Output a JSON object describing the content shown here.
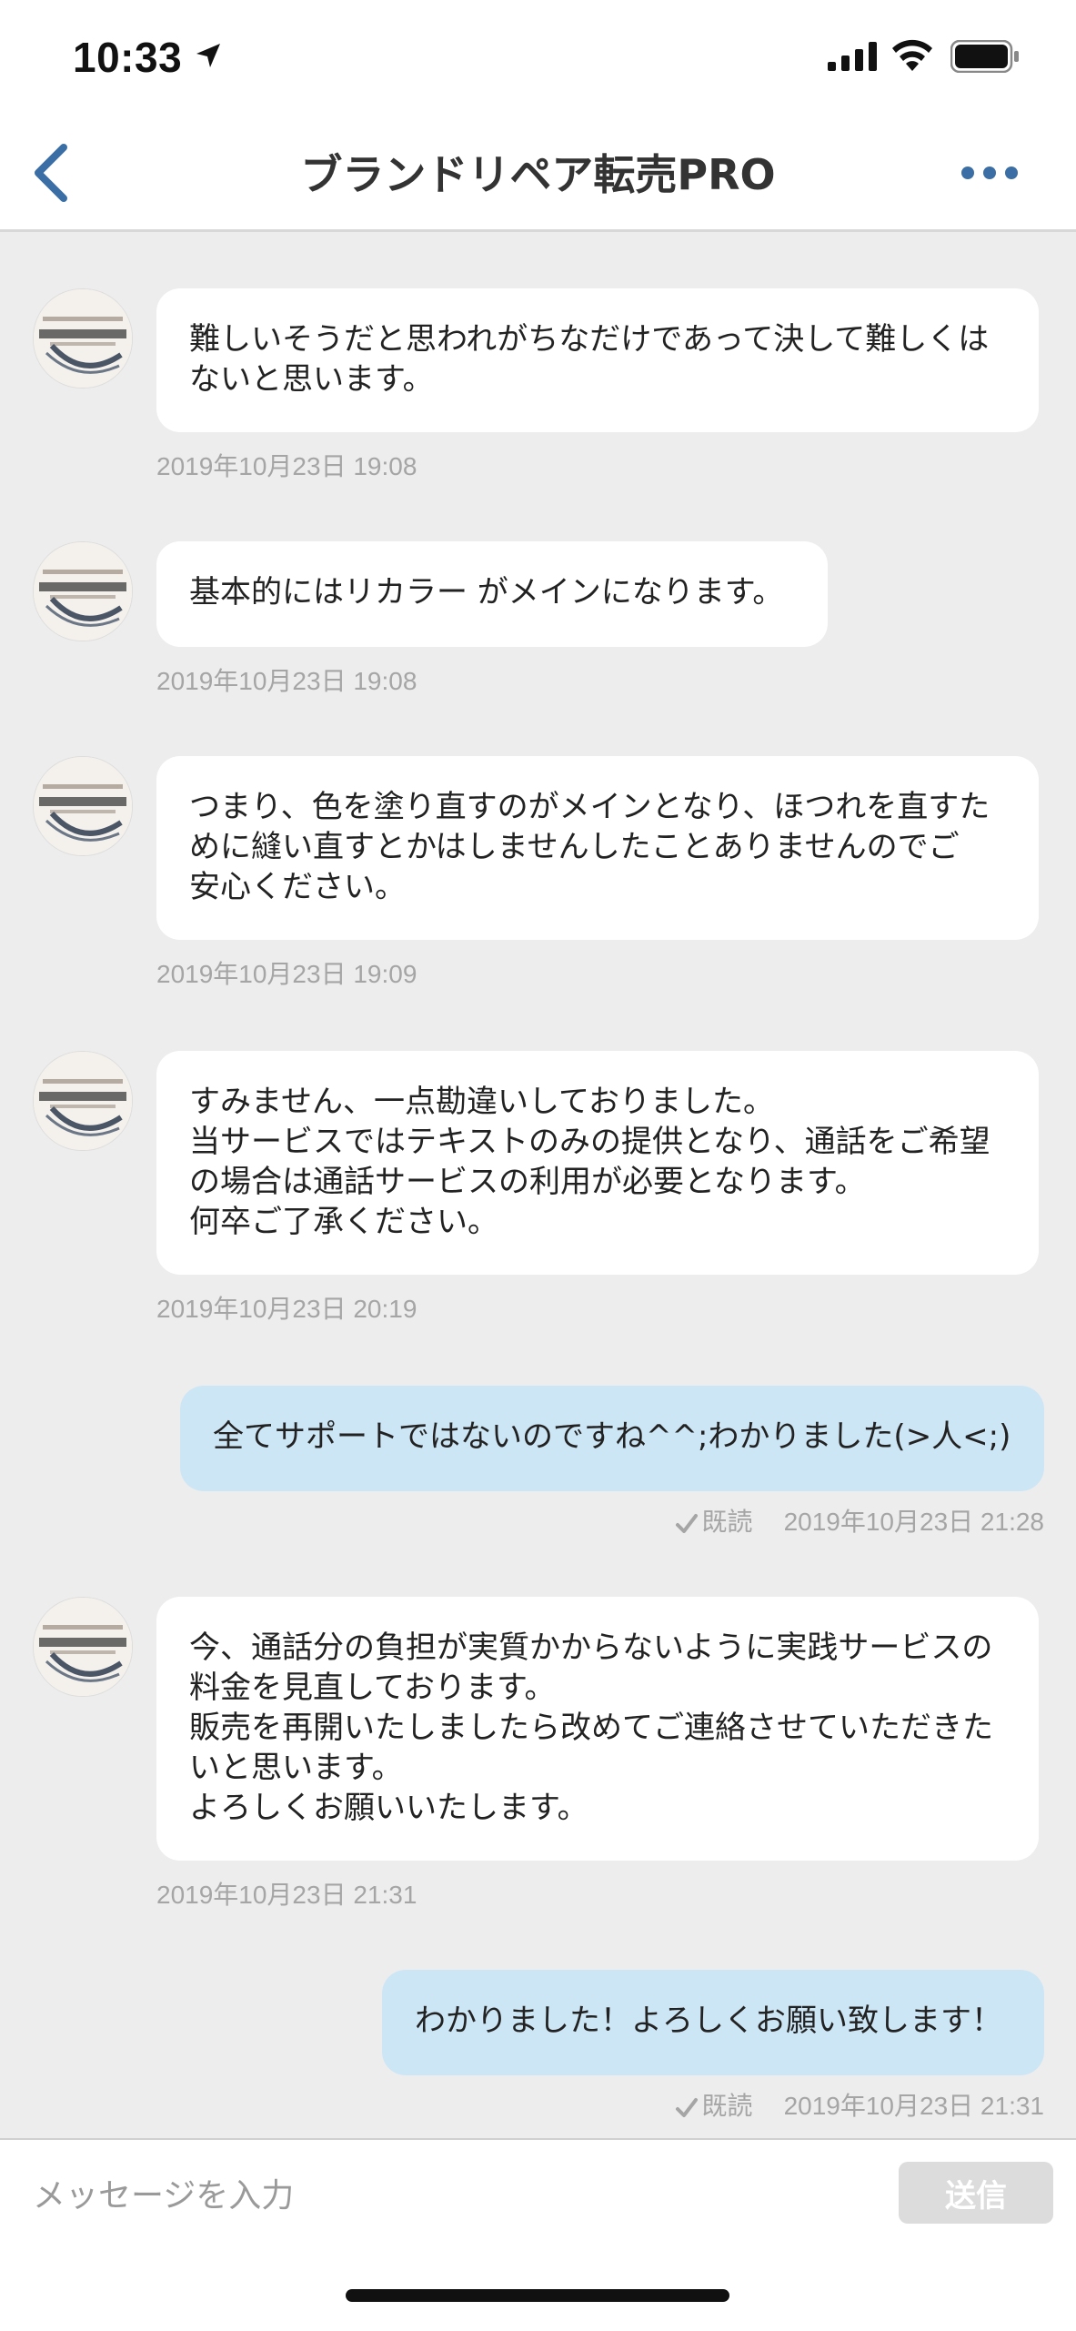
{
  "status_bar": {
    "time": "10:33",
    "icons": [
      "location-arrow-icon",
      "cellular-signal-icon",
      "wifi-icon",
      "battery-icon"
    ]
  },
  "nav": {
    "title": "ブランドリペア転売PRO",
    "back_icon": "chevron-left-icon",
    "more_icon": "more-dots-icon",
    "accent_color": "#3a6ea5"
  },
  "messages": [
    {
      "direction": "in",
      "text": "難しいそうだと思われがちなだけであって決して難しくは\nないと思います。",
      "timestamp": "2019年10月23日 19:08"
    },
    {
      "direction": "in",
      "text": "基本的にはリカラー がメインになります。",
      "timestamp": "2019年10月23日 19:08"
    },
    {
      "direction": "in",
      "text": "つまり、色を塗り直すのがメインとなり、ほつれを直すた\nめに縫い直すとかはしませんしたことありませんのでご\n安心ください。",
      "timestamp": "2019年10月23日 19:09"
    },
    {
      "direction": "in",
      "text": "すみません、一点勘違いしておりました。\n当サービスではテキストのみの提供となり、通話をご希望\nの場合は通話サービスの利用が必要となります。\n何卒ご了承ください。",
      "timestamp": "2019年10月23日 20:19"
    },
    {
      "direction": "out",
      "text": "全てサポートではないのですね^^;わかりました(>人<;)",
      "read_label": "既読",
      "timestamp": "2019年10月23日 21:28"
    },
    {
      "direction": "in",
      "text": "今、通話分の負担が実質かからないように実践サービスの\n料金を見直しております。\n販売を再開いたしましたら改めてご連絡させていただきた\nいと思います。\nよろしくお願いいたします。",
      "timestamp": "2019年10月23日 21:31"
    },
    {
      "direction": "out",
      "text": "わかりました！よろしくお願い致します！",
      "read_label": "既読",
      "timestamp": "2019年10月23日 21:31"
    }
  ],
  "input_bar": {
    "placeholder": "メッセージを入力",
    "send_label": "送信"
  },
  "colors": {
    "background": "#ededed",
    "incoming_bubble": "#ffffff",
    "outgoing_bubble": "#cde6f5",
    "timestamp": "#a5a5a5"
  }
}
